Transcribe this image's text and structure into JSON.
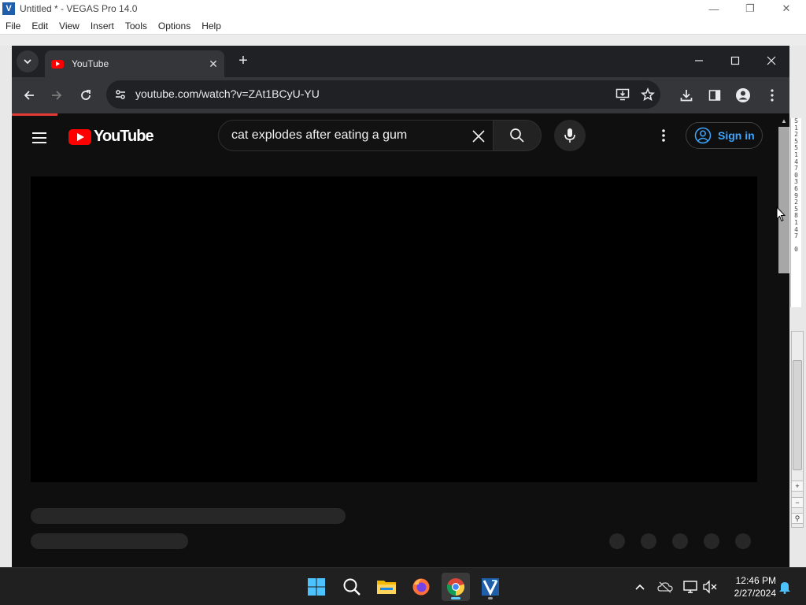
{
  "vegas": {
    "title": "Untitled * - VEGAS Pro 14.0",
    "menu": [
      "File",
      "Edit",
      "View",
      "Insert",
      "Tools",
      "Options",
      "Help"
    ],
    "ruler_digits": "S\n1\n2\n5\n5\n1\n4\n7\n0\n3\n6\n9\n2\n5\n8\n1\n4\n7\n\n0"
  },
  "browser": {
    "tab_title": "YouTube",
    "url": "youtube.com/watch?v=ZAt1BCyU-YU",
    "accent_progress_color": "#e53935"
  },
  "youtube": {
    "logo_text": "YouTube",
    "search_query": "cat explodes after eating a gum",
    "sign_in_label": "Sign in",
    "brand_color": "#ff0000",
    "link_color": "#3ea6ff"
  },
  "taskbar": {
    "apps": [
      "start-icon",
      "search-icon",
      "file-explorer-icon",
      "firefox-icon",
      "chrome-icon",
      "vegas-pro-icon"
    ],
    "time": "12:46 PM",
    "date": "2/27/2024"
  }
}
